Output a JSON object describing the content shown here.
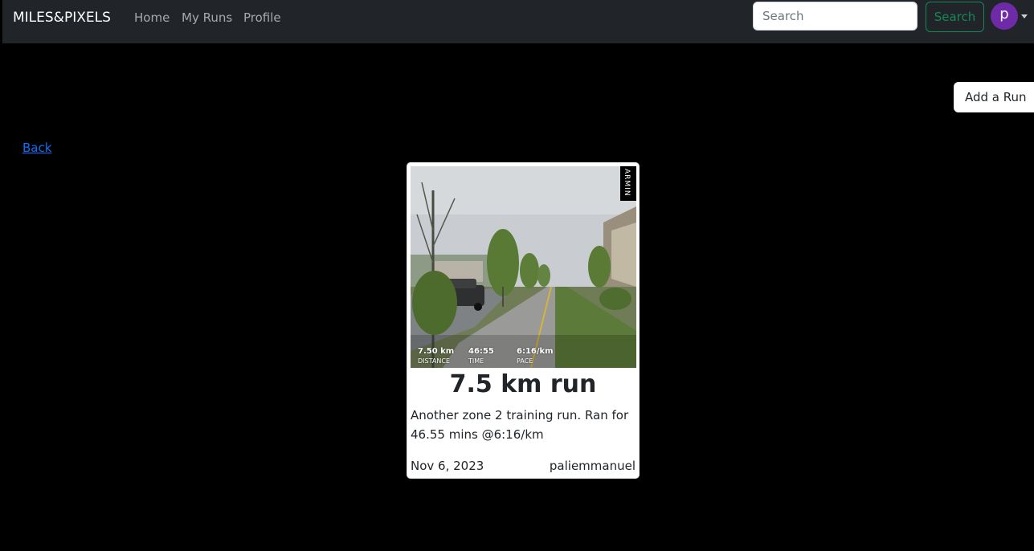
{
  "navbar": {
    "brand": "MILES&PIXELS",
    "links": [
      {
        "label": "Home"
      },
      {
        "label": "My Runs"
      },
      {
        "label": "Profile"
      }
    ],
    "search": {
      "placeholder": "Search",
      "value": "",
      "button_label": "Search"
    },
    "user": {
      "avatar_letter": "p",
      "avatar_color": "#6f2aa8"
    }
  },
  "actions": {
    "add_run_label": "Add a Run",
    "back_label": "Back"
  },
  "run_card": {
    "title": "7.5 km run",
    "description": "Another zone 2 training run. Ran for 46.55 mins @6:16/km",
    "date": "Nov 6, 2023",
    "username": "paliemmanuel",
    "photo": {
      "watermark": "ARMIN",
      "stats": [
        {
          "value": "7.50 km",
          "label": "DISTANCE"
        },
        {
          "value": "46:55",
          "label": "TIME"
        },
        {
          "value": "6:16/km",
          "label": "PACE"
        }
      ]
    }
  },
  "colors": {
    "page_bg": "#000000",
    "navbar_bg": "#212529",
    "success": "#198754",
    "link": "#0d6efd"
  }
}
